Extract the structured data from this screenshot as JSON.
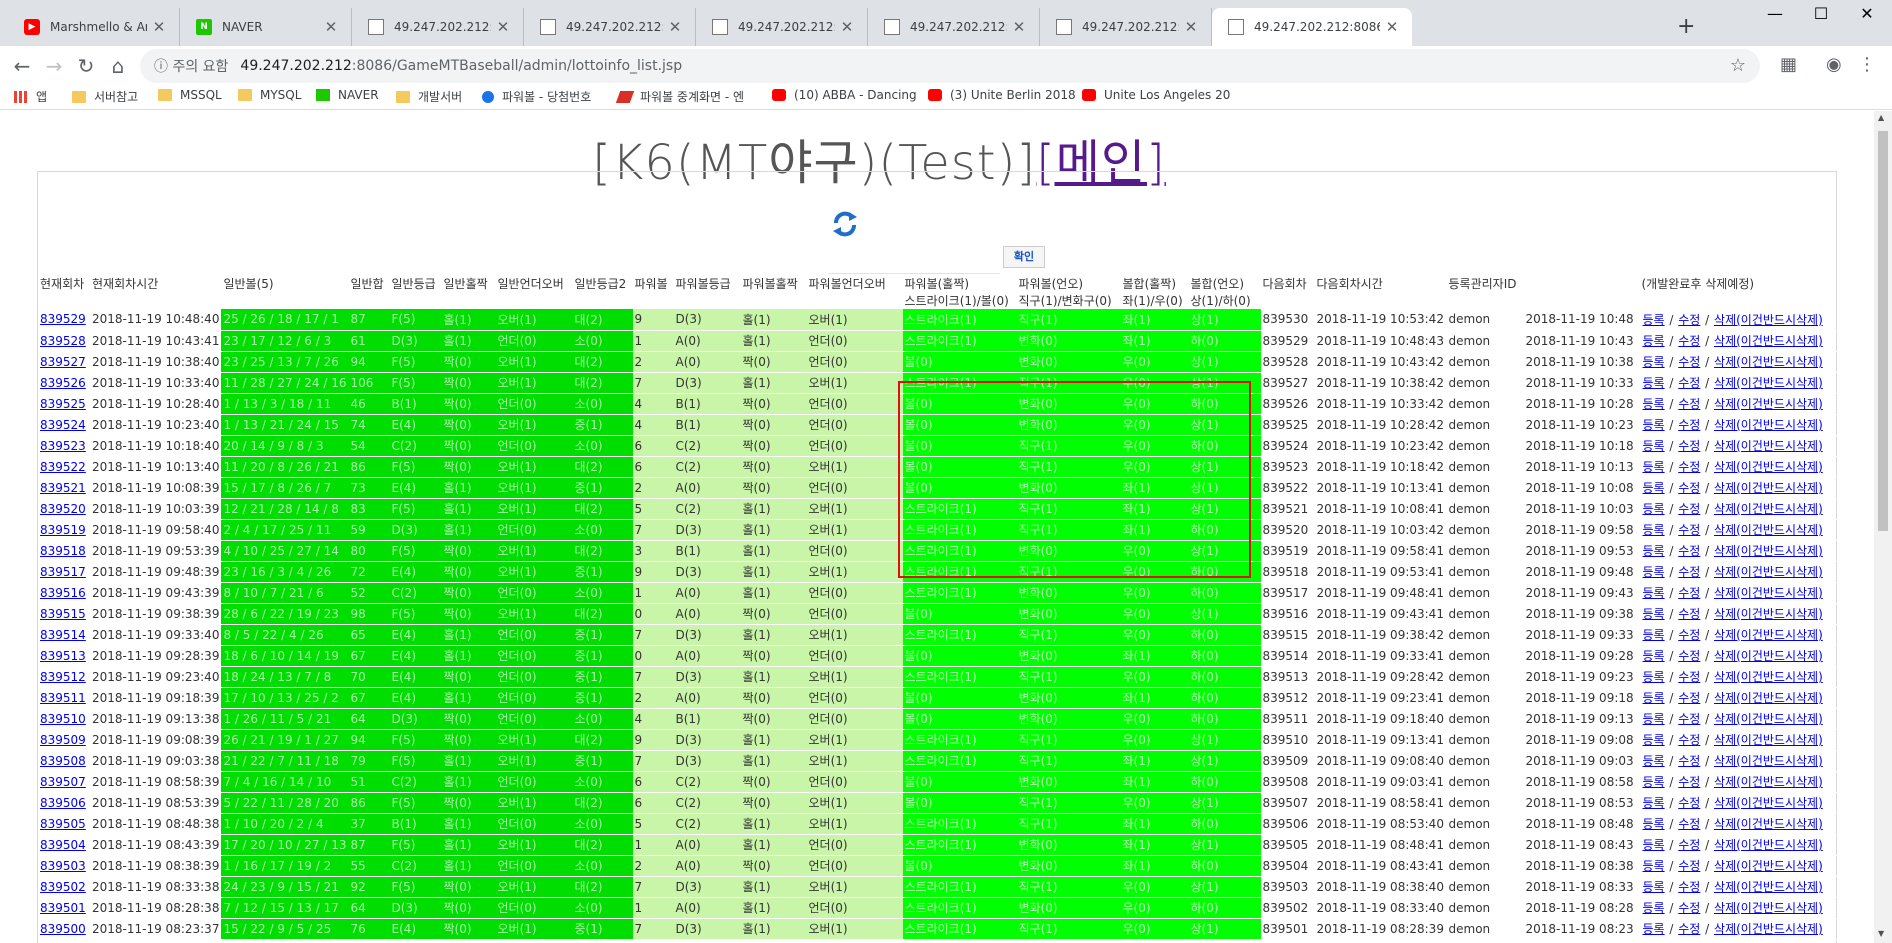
{
  "browser": {
    "tabs": [
      {
        "title": "Marshmello & Anne-Marie",
        "icon": "youtube-icon"
      },
      {
        "title": "NAVER",
        "icon": "naver-icon"
      },
      {
        "title": "49.247.202.212:8086/GameM",
        "icon": "page-icon"
      },
      {
        "title": "49.247.202.212:8086/GameM",
        "icon": "page-icon"
      },
      {
        "title": "49.247.202.212:8086/GameM",
        "icon": "page-icon"
      },
      {
        "title": "49.247.202.212:8086/GameM",
        "icon": "page-icon"
      },
      {
        "title": "49.247.202.212:8086/GameM",
        "icon": "page-icon"
      },
      {
        "title": "49.247.202.212:8086/GameM",
        "icon": "page-icon"
      }
    ],
    "address": {
      "warning": "ⓘ 주의 요함",
      "host": "49.247.202.212",
      "path": ":8086/GameMTBaseball/admin/lottoinfo_list.jsp"
    },
    "bookmarks": [
      "앱",
      "서버참고",
      "MSSQL",
      "MYSQL",
      "NAVER",
      "개발서버",
      "파워볼 - 당첨번호",
      "파워볼 중계화면 - 엔",
      "(10) ABBA - Dancing",
      "(3) Unite Berlin 2018",
      "Unite Los Angeles 20"
    ]
  },
  "page": {
    "title": "[K6(MT야구)(Test)]",
    "main_link": "[메인]",
    "confirm_label": "확인"
  },
  "table": {
    "headers": [
      "현재회차",
      "현재회차시간",
      "일반볼(5)",
      "일반합",
      "일반등급",
      "일반홀짝",
      "일반언더오버",
      "일반등급2",
      "파워볼",
      "파워볼등급",
      "파워볼홀짝",
      "파워볼언더오버",
      "파워볼(홀짝)\n스트라이크(1)/볼(0)",
      "파워볼(언오)\n직구(1)/변화구(0)",
      "볼합(홀짝)\n좌(1)/우(0)",
      "볼합(언오)\n상(1)/하(0)",
      "다음회차",
      "다음회차시간",
      "등록관리자ID",
      "",
      "(개발완료후 삭제예정)"
    ],
    "actions": [
      "등록",
      "수정",
      "삭제(이건반드시삭제)"
    ],
    "rows": [
      [
        "839529",
        "2018-11-19 10:48:40",
        "25 / 26 / 18 / 17 / 1",
        "87",
        "F(5)",
        "홀(1)",
        "오버(1)",
        "대(2)",
        "9",
        "D(3)",
        "홀(1)",
        "오버(1)",
        "스트라이크(1)",
        "직구(1)",
        "좌(1)",
        "상(1)",
        "839530",
        "2018-11-19 10:53:42",
        "demon",
        "2018-11-19 10:48"
      ],
      [
        "839528",
        "2018-11-19 10:43:41",
        "23 / 17 / 12 / 6 / 3",
        "61",
        "D(3)",
        "홀(1)",
        "언더(0)",
        "소(0)",
        "1",
        "A(0)",
        "홀(1)",
        "언더(0)",
        "스트라이크(1)",
        "변화(0)",
        "좌(1)",
        "하(0)",
        "839529",
        "2018-11-19 10:48:43",
        "demon",
        "2018-11-19 10:43"
      ],
      [
        "839527",
        "2018-11-19 10:38:40",
        "23 / 25 / 13 / 7 / 26",
        "94",
        "F(5)",
        "짝(0)",
        "오버(1)",
        "대(2)",
        "2",
        "A(0)",
        "짝(0)",
        "언더(0)",
        "볼(0)",
        "변화(0)",
        "우(0)",
        "상(1)",
        "839528",
        "2018-11-19 10:43:42",
        "demon",
        "2018-11-19 10:38"
      ],
      [
        "839526",
        "2018-11-19 10:33:40",
        "11 / 28 / 27 / 24 / 16",
        "106",
        "F(5)",
        "짝(0)",
        "오버(1)",
        "대(2)",
        "7",
        "D(3)",
        "홀(1)",
        "오버(1)",
        "스트라이크(1)",
        "직구(1)",
        "우(0)",
        "상(1)",
        "839527",
        "2018-11-19 10:38:42",
        "demon",
        "2018-11-19 10:33"
      ],
      [
        "839525",
        "2018-11-19 10:28:40",
        "1 / 13 / 3 / 18 / 11",
        "46",
        "B(1)",
        "짝(0)",
        "언더(0)",
        "소(0)",
        "4",
        "B(1)",
        "짝(0)",
        "언더(0)",
        "볼(0)",
        "변화(0)",
        "우(0)",
        "하(0)",
        "839526",
        "2018-11-19 10:33:42",
        "demon",
        "2018-11-19 10:28"
      ],
      [
        "839524",
        "2018-11-19 10:23:40",
        "1 / 13 / 21 / 24 / 15",
        "74",
        "E(4)",
        "짝(0)",
        "오버(1)",
        "중(1)",
        "4",
        "B(1)",
        "짝(0)",
        "언더(0)",
        "볼(0)",
        "변화(0)",
        "우(0)",
        "상(1)",
        "839525",
        "2018-11-19 10:28:42",
        "demon",
        "2018-11-19 10:23"
      ],
      [
        "839523",
        "2018-11-19 10:18:40",
        "20 / 14 / 9 / 8 / 3",
        "54",
        "C(2)",
        "짝(0)",
        "언더(0)",
        "소(0)",
        "6",
        "C(2)",
        "짝(0)",
        "언더(0)",
        "볼(0)",
        "직구(1)",
        "우(0)",
        "하(0)",
        "839524",
        "2018-11-19 10:23:42",
        "demon",
        "2018-11-19 10:18"
      ],
      [
        "839522",
        "2018-11-19 10:13:40",
        "11 / 20 / 8 / 26 / 21",
        "86",
        "F(5)",
        "짝(0)",
        "오버(1)",
        "대(2)",
        "6",
        "C(2)",
        "짝(0)",
        "오버(1)",
        "볼(0)",
        "직구(1)",
        "우(0)",
        "상(1)",
        "839523",
        "2018-11-19 10:18:42",
        "demon",
        "2018-11-19 10:13"
      ],
      [
        "839521",
        "2018-11-19 10:08:39",
        "15 / 17 / 8 / 26 / 7",
        "73",
        "E(4)",
        "홀(1)",
        "오버(1)",
        "중(1)",
        "2",
        "A(0)",
        "짝(0)",
        "언더(0)",
        "볼(0)",
        "변화(0)",
        "좌(1)",
        "상(1)",
        "839522",
        "2018-11-19 10:13:41",
        "demon",
        "2018-11-19 10:08"
      ],
      [
        "839520",
        "2018-11-19 10:03:39",
        "12 / 21 / 28 / 14 / 8",
        "83",
        "F(5)",
        "홀(1)",
        "오버(1)",
        "대(2)",
        "5",
        "C(2)",
        "홀(1)",
        "오버(1)",
        "스트라이크(1)",
        "직구(1)",
        "좌(1)",
        "상(1)",
        "839521",
        "2018-11-19 10:08:41",
        "demon",
        "2018-11-19 10:03"
      ],
      [
        "839519",
        "2018-11-19 09:58:40",
        "2 / 4 / 17 / 25 / 11",
        "59",
        "D(3)",
        "홀(1)",
        "언더(0)",
        "소(0)",
        "7",
        "D(3)",
        "홀(1)",
        "오버(1)",
        "스트라이크(1)",
        "직구(1)",
        "좌(1)",
        "하(0)",
        "839520",
        "2018-11-19 10:03:42",
        "demon",
        "2018-11-19 09:58"
      ],
      [
        "839518",
        "2018-11-19 09:53:39",
        "4 / 10 / 25 / 27 / 14",
        "80",
        "F(5)",
        "짝(0)",
        "오버(1)",
        "대(2)",
        "3",
        "B(1)",
        "홀(1)",
        "언더(0)",
        "스트라이크(1)",
        "변화(0)",
        "우(0)",
        "상(1)",
        "839519",
        "2018-11-19 09:58:41",
        "demon",
        "2018-11-19 09:53"
      ],
      [
        "839517",
        "2018-11-19 09:48:39",
        "23 / 16 / 3 / 4 / 26",
        "72",
        "E(4)",
        "짝(0)",
        "오버(1)",
        "중(1)",
        "9",
        "D(3)",
        "홀(1)",
        "오버(1)",
        "스트라이크(1)",
        "직구(1)",
        "우(0)",
        "하(0)",
        "839518",
        "2018-11-19 09:53:41",
        "demon",
        "2018-11-19 09:48"
      ],
      [
        "839516",
        "2018-11-19 09:43:39",
        "8 / 10 / 7 / 21 / 6",
        "52",
        "C(2)",
        "짝(0)",
        "언더(0)",
        "소(0)",
        "1",
        "A(0)",
        "홀(1)",
        "언더(0)",
        "스트라이크(1)",
        "변화(0)",
        "우(0)",
        "하(0)",
        "839517",
        "2018-11-19 09:48:41",
        "demon",
        "2018-11-19 09:43"
      ],
      [
        "839515",
        "2018-11-19 09:38:39",
        "28 / 6 / 22 / 19 / 23",
        "98",
        "F(5)",
        "짝(0)",
        "오버(1)",
        "대(2)",
        "0",
        "A(0)",
        "짝(0)",
        "언더(0)",
        "볼(0)",
        "변화(0)",
        "우(0)",
        "상(1)",
        "839516",
        "2018-11-19 09:43:41",
        "demon",
        "2018-11-19 09:38"
      ],
      [
        "839514",
        "2018-11-19 09:33:40",
        "8 / 5 / 22 / 4 / 26",
        "65",
        "E(4)",
        "홀(1)",
        "언더(0)",
        "중(1)",
        "7",
        "D(3)",
        "홀(1)",
        "오버(1)",
        "스트라이크(1)",
        "직구(1)",
        "우(0)",
        "하(0)",
        "839515",
        "2018-11-19 09:38:42",
        "demon",
        "2018-11-19 09:33"
      ],
      [
        "839513",
        "2018-11-19 09:28:39",
        "18 / 6 / 10 / 14 / 19",
        "67",
        "E(4)",
        "홀(1)",
        "언더(0)",
        "중(1)",
        "0",
        "A(0)",
        "짝(0)",
        "언더(0)",
        "볼(0)",
        "변화(0)",
        "좌(1)",
        "하(0)",
        "839514",
        "2018-11-19 09:33:41",
        "demon",
        "2018-11-19 09:28"
      ],
      [
        "839512",
        "2018-11-19 09:23:40",
        "18 / 24 / 13 / 7 / 8",
        "70",
        "E(4)",
        "짝(0)",
        "언더(0)",
        "중(1)",
        "7",
        "D(3)",
        "홀(1)",
        "오버(1)",
        "스트라이크(1)",
        "직구(1)",
        "우(0)",
        "하(0)",
        "839513",
        "2018-11-19 09:28:42",
        "demon",
        "2018-11-19 09:23"
      ],
      [
        "839511",
        "2018-11-19 09:18:39",
        "17 / 10 / 13 / 25 / 2",
        "67",
        "E(4)",
        "홀(1)",
        "언더(0)",
        "중(1)",
        "2",
        "A(0)",
        "짝(0)",
        "언더(0)",
        "볼(0)",
        "변화(0)",
        "좌(1)",
        "하(0)",
        "839512",
        "2018-11-19 09:23:41",
        "demon",
        "2018-11-19 09:18"
      ],
      [
        "839510",
        "2018-11-19 09:13:38",
        "1 / 26 / 11 / 5 / 21",
        "64",
        "D(3)",
        "짝(0)",
        "언더(0)",
        "소(0)",
        "4",
        "B(1)",
        "짝(0)",
        "언더(0)",
        "볼(0)",
        "변화(0)",
        "우(0)",
        "하(0)",
        "839511",
        "2018-11-19 09:18:40",
        "demon",
        "2018-11-19 09:13"
      ],
      [
        "839509",
        "2018-11-19 09:08:39",
        "26 / 21 / 19 / 1 / 27",
        "94",
        "F(5)",
        "짝(0)",
        "오버(1)",
        "대(2)",
        "9",
        "D(3)",
        "홀(1)",
        "오버(1)",
        "스트라이크(1)",
        "직구(1)",
        "우(0)",
        "상(1)",
        "839510",
        "2018-11-19 09:13:41",
        "demon",
        "2018-11-19 09:08"
      ],
      [
        "839508",
        "2018-11-19 09:03:38",
        "21 / 22 / 7 / 11 / 18",
        "79",
        "F(5)",
        "홀(1)",
        "오버(1)",
        "중(1)",
        "7",
        "D(3)",
        "홀(1)",
        "오버(1)",
        "스트라이크(1)",
        "직구(1)",
        "좌(1)",
        "상(1)",
        "839509",
        "2018-11-19 09:08:40",
        "demon",
        "2018-11-19 09:03"
      ],
      [
        "839507",
        "2018-11-19 08:58:39",
        "7 / 4 / 16 / 14 / 10",
        "51",
        "C(2)",
        "홀(1)",
        "언더(0)",
        "소(0)",
        "6",
        "C(2)",
        "짝(0)",
        "언더(0)",
        "볼(0)",
        "변화(0)",
        "좌(1)",
        "하(0)",
        "839508",
        "2018-11-19 09:03:41",
        "demon",
        "2018-11-19 08:58"
      ],
      [
        "839506",
        "2018-11-19 08:53:39",
        "5 / 22 / 11 / 28 / 20",
        "86",
        "F(5)",
        "짝(0)",
        "오버(1)",
        "대(2)",
        "6",
        "C(2)",
        "짝(0)",
        "오버(1)",
        "볼(0)",
        "직구(1)",
        "우(0)",
        "상(1)",
        "839507",
        "2018-11-19 08:58:41",
        "demon",
        "2018-11-19 08:53"
      ],
      [
        "839505",
        "2018-11-19 08:48:38",
        "1 / 10 / 20 / 2 / 4",
        "37",
        "B(1)",
        "홀(1)",
        "언더(0)",
        "소(0)",
        "5",
        "C(2)",
        "홀(1)",
        "오버(1)",
        "스트라이크(1)",
        "직구(1)",
        "좌(1)",
        "하(0)",
        "839506",
        "2018-11-19 08:53:40",
        "demon",
        "2018-11-19 08:48"
      ],
      [
        "839504",
        "2018-11-19 08:43:39",
        "17 / 20 / 10 / 27 / 13",
        "87",
        "F(5)",
        "홀(1)",
        "오버(1)",
        "대(2)",
        "1",
        "A(0)",
        "홀(1)",
        "언더(0)",
        "스트라이크(1)",
        "변화(0)",
        "좌(1)",
        "상(1)",
        "839505",
        "2018-11-19 08:48:41",
        "demon",
        "2018-11-19 08:43"
      ],
      [
        "839503",
        "2018-11-19 08:38:39",
        "1 / 16 / 17 / 19 / 2",
        "55",
        "C(2)",
        "홀(1)",
        "언더(0)",
        "소(0)",
        "2",
        "A(0)",
        "짝(0)",
        "언더(0)",
        "볼(0)",
        "변화(0)",
        "좌(1)",
        "하(0)",
        "839504",
        "2018-11-19 08:43:41",
        "demon",
        "2018-11-19 08:38"
      ],
      [
        "839502",
        "2018-11-19 08:33:38",
        "24 / 23 / 9 / 15 / 21",
        "92",
        "F(5)",
        "짝(0)",
        "오버(1)",
        "대(2)",
        "7",
        "D(3)",
        "홀(1)",
        "오버(1)",
        "스트라이크(1)",
        "직구(1)",
        "우(0)",
        "상(1)",
        "839503",
        "2018-11-19 08:38:40",
        "demon",
        "2018-11-19 08:33"
      ],
      [
        "839501",
        "2018-11-19 08:28:38",
        "7 / 12 / 15 / 13 / 17",
        "64",
        "D(3)",
        "짝(0)",
        "언더(0)",
        "소(0)",
        "1",
        "A(0)",
        "홀(1)",
        "언더(0)",
        "스트라이크(1)",
        "변화(0)",
        "우(0)",
        "하(0)",
        "839502",
        "2018-11-19 08:33:40",
        "demon",
        "2018-11-19 08:28"
      ],
      [
        "839500",
        "2018-11-19 08:23:37",
        "15 / 22 / 9 / 5 / 25",
        "76",
        "E(4)",
        "짝(0)",
        "오버(1)",
        "중(1)",
        "7",
        "D(3)",
        "홀(1)",
        "오버(1)",
        "스트라이크(1)",
        "직구(1)",
        "우(0)",
        "상(1)",
        "839501",
        "2018-11-19 08:28:39",
        "demon",
        "2018-11-19 08:23"
      ]
    ]
  }
}
